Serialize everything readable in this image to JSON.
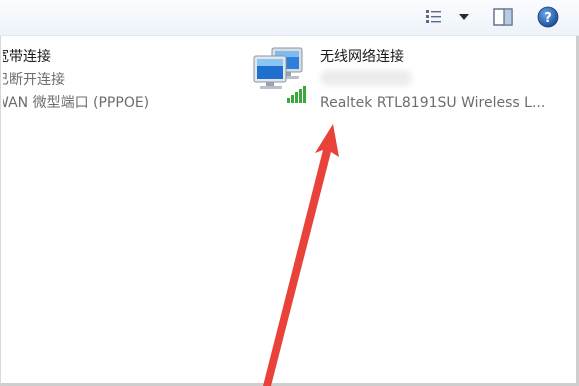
{
  "toolbar": {
    "view_icon": "change-view-icon",
    "dropdown_icon": "chevron-down-icon",
    "preview_pane_icon": "preview-pane-icon",
    "help_icon": "help-icon",
    "help_glyph": "?"
  },
  "connections": {
    "broadband": {
      "name": "宽带连接",
      "status": "已断开连接",
      "device": "WAN 微型端口 (PPPOE)"
    },
    "wireless": {
      "name": "无线网络连接",
      "device": "Realtek RTL8191SU Wireless L..."
    }
  },
  "annotation": {
    "arrow_color": "#e8423a"
  }
}
